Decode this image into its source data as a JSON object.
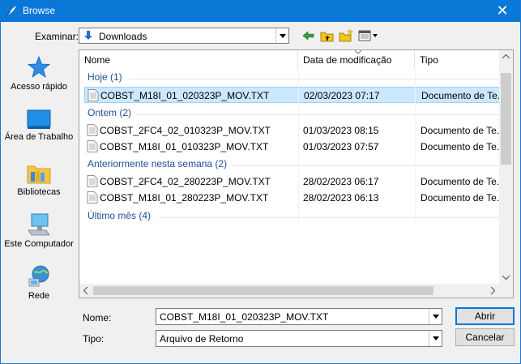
{
  "window": {
    "title": "Browse",
    "close_glyph": "✕"
  },
  "look_in": {
    "label": "Examinar:",
    "value": "Downloads"
  },
  "places": [
    {
      "label": "Acesso rápido",
      "icon": "star-icon"
    },
    {
      "label": "Área de Trabalho",
      "icon": "desktop-icon"
    },
    {
      "label": "Bibliotecas",
      "icon": "libraries-icon"
    },
    {
      "label": "Este Computador",
      "icon": "computer-icon"
    },
    {
      "label": "Rede",
      "icon": "network-icon"
    }
  ],
  "columns": {
    "name": "Nome",
    "date": "Data de modificação",
    "type": "Tipo"
  },
  "groups": [
    {
      "label": "Hoje (1)"
    },
    {
      "label": "Ontem (2)"
    },
    {
      "label": "Anteriormente nesta semana (2)"
    },
    {
      "label": "Último mês (4)"
    }
  ],
  "files": [
    {
      "name": "COBST_M18I_01_020323P_MOV.TXT",
      "date": "02/03/2023 07:17",
      "type": "Documento de Te...",
      "selected": true
    },
    {
      "name": "COBST_2FC4_02_010323P_MOV.TXT",
      "date": "01/03/2023 08:15",
      "type": "Documento de Te..."
    },
    {
      "name": "COBST_M18I_01_010323P_MOV.TXT",
      "date": "01/03/2023 07:57",
      "type": "Documento de Te..."
    },
    {
      "name": "COBST_2FC4_02_280223P_MOV.TXT",
      "date": "28/02/2023 06:17",
      "type": "Documento de Te..."
    },
    {
      "name": "COBST_M18I_01_280223P_MOV.TXT",
      "date": "28/02/2023 06:13",
      "type": "Documento de Te..."
    }
  ],
  "filename": {
    "label": "Nome:",
    "value": "COBST_M18I_01_020323P_MOV.TXT"
  },
  "filetype": {
    "label": "Tipo:",
    "value": "Arquivo de Retorno"
  },
  "buttons": {
    "open": "Abrir",
    "cancel": "Cancelar"
  },
  "colors": {
    "titlebar": "#0a78d7",
    "selection": "#cce8ff",
    "group_text": "#1e4e9a"
  }
}
